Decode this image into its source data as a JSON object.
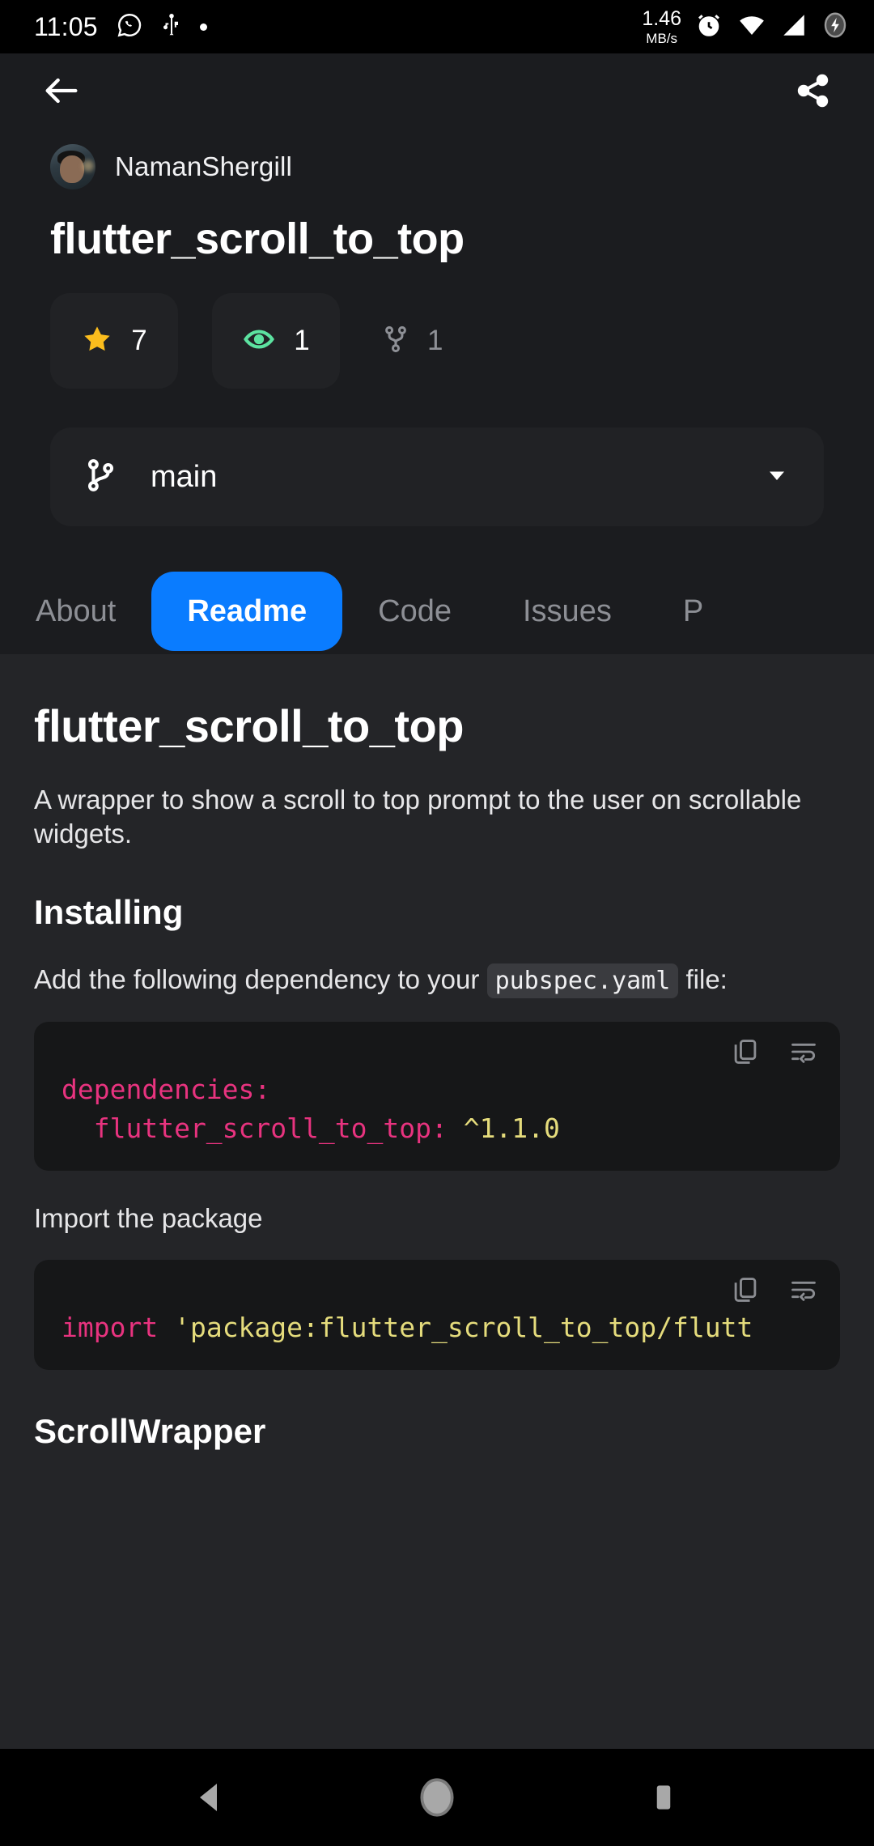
{
  "statusbar": {
    "time": "11:05",
    "network_speed": "1.46",
    "network_unit": "MB/s",
    "icons": [
      "whatsapp-icon",
      "usb-icon",
      "dot-indicator",
      "alarm-icon",
      "wifi-icon",
      "signal-icon",
      "battery-charging-icon"
    ]
  },
  "appbar": {
    "back_label": "Back",
    "share_label": "Share"
  },
  "repo": {
    "owner": "NamanShergill",
    "name": "flutter_scroll_to_top",
    "stats": [
      {
        "icon": "star-icon",
        "value": "7",
        "color": "#fbbd1d",
        "carded": true
      },
      {
        "icon": "eye-icon",
        "value": "1",
        "color": "#5ce2a0",
        "carded": true
      },
      {
        "icon": "fork-icon",
        "value": "1",
        "color": "#8e9096",
        "carded": false
      }
    ],
    "branch": "main"
  },
  "tabs": [
    {
      "label": "About",
      "active": false
    },
    {
      "label": "Readme",
      "active": true
    },
    {
      "label": "Code",
      "active": false
    },
    {
      "label": "Issues",
      "active": false
    },
    {
      "label": "P",
      "active": false
    }
  ],
  "readme": {
    "title": "flutter_scroll_to_top",
    "description": "A wrapper to show a scroll to top prompt to the user on scrollable widgets.",
    "installing_heading": "Installing",
    "installing_text_before": "Add the following dependency to your",
    "installing_code_inline": "pubspec.yaml",
    "installing_text_after": "file:",
    "yaml_key_line1": "dependencies:",
    "yaml_key_line2": "  flutter_scroll_to_top:",
    "yaml_value_line2": " ^1.1.0",
    "import_text": "Import the package",
    "import_keyword": "import",
    "import_path": " 'package:flutter_scroll_to_top/flutt",
    "scrollwrapper_heading": "ScrollWrapper",
    "code_actions": [
      "copy-icon",
      "wrap-text-icon"
    ]
  },
  "navbar": {
    "back": "back-triangle-icon",
    "home": "home-circle-icon",
    "recents": "recents-square-icon"
  },
  "colors": {
    "accent": "#0a7cff",
    "star": "#fbbd1d",
    "eye": "#5ce2a0",
    "code_key": "#e8337f",
    "code_string": "#e5dc7c",
    "background": "#1b1c1f",
    "readme_background": "#242528"
  }
}
